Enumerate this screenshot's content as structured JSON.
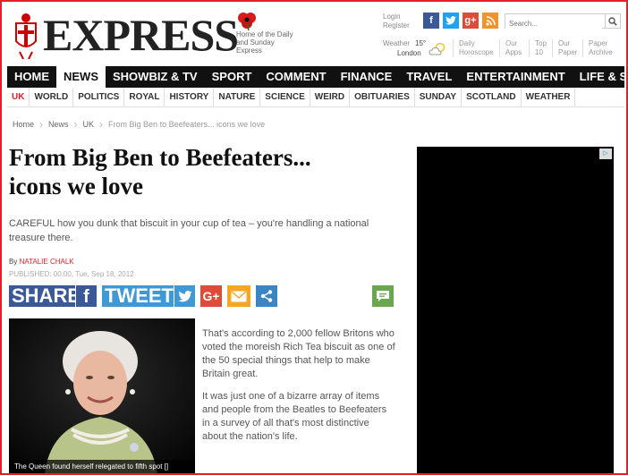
{
  "masthead": {
    "logo": "EXPRESS",
    "tagline": "Home of the Daily and Sunday Express",
    "login": "Login",
    "register": "Register",
    "weather_label": "Weather",
    "temperature": "15°",
    "city": "London",
    "quick_links": [
      {
        "line1": "Daily",
        "line2": "Horoscope"
      },
      {
        "line1": "Our",
        "line2": "Apps"
      },
      {
        "line1": "Top",
        "line2": "10"
      },
      {
        "line1": "Our",
        "line2": "Paper"
      },
      {
        "line1": "Paper",
        "line2": "Archive"
      }
    ],
    "search_placeholder": "Search...",
    "social": [
      {
        "icon": "facebook-icon",
        "glyph": "f",
        "color": "#3b5998"
      },
      {
        "icon": "twitter-icon",
        "glyph": "t",
        "color": "#1da1f2"
      },
      {
        "icon": "google-plus-icon",
        "glyph": "g+",
        "color": "#dd4b39"
      },
      {
        "icon": "rss-icon",
        "glyph": "≡",
        "color": "#f0932b"
      }
    ]
  },
  "nav": {
    "items": [
      "HOME",
      "NEWS",
      "SHOWBIZ & TV",
      "SPORT",
      "COMMENT",
      "FINANCE",
      "TRAVEL",
      "ENTERTAINMENT",
      "LIFE & STYLE"
    ],
    "active": "NEWS"
  },
  "subnav": {
    "items": [
      "UK",
      "WORLD",
      "POLITICS",
      "ROYAL",
      "HISTORY",
      "NATURE",
      "SCIENCE",
      "WEIRD",
      "OBITUARIES",
      "SUNDAY",
      "SCOTLAND",
      "WEATHER"
    ],
    "active": "UK"
  },
  "breadcrumb": [
    "Home",
    "News",
    "UK",
    "From Big Ben to Beefeaters... icons we love"
  ],
  "article": {
    "headline_line1": "From Big Ben to Beefeaters...",
    "headline_line2": "icons we love",
    "standfirst": "CAREFUL how you dunk that biscuit in your cup of tea – you're handling a national treasure there.",
    "by": "By",
    "author": "NATALIE CHALK",
    "published": "PUBLISHED: 00:00, Tue, Sep 18, 2012",
    "share_label": "SHARE",
    "tweet_label": "TWEET",
    "image_caption": "The Queen found herself relegated to fifth spot []",
    "paragraphs": [
      "That's according to 2,000 fellow Britons who voted the moreish Rich Tea biscuit as one of the 50 special things that help to make Britain great.",
      "It was just one of a bizarre array of items and people from the Beatles to Beefeaters in a survey of all that's most distinctive about the nation's life."
    ]
  },
  "colors": {
    "brand_red": "#e3202a",
    "facebook": "#3b5998",
    "twitter": "#4099d4",
    "google": "#dd4b39",
    "email": "#f5a623",
    "sharethis": "#3c84c4",
    "comments": "#6aa84f"
  }
}
